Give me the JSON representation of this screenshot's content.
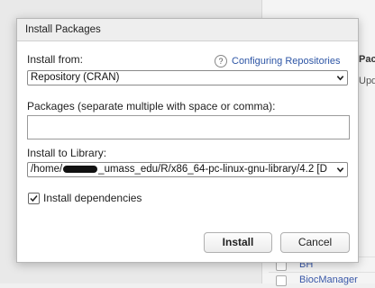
{
  "background": {
    "header": "Pac",
    "subheader": "Upd",
    "rows": [
      "BH",
      "BiocManager"
    ]
  },
  "dialog": {
    "title": "Install Packages",
    "install_from_label": "Install from:",
    "help_link": "Configuring Repositories",
    "install_from_value": "Repository (CRAN)",
    "packages_label": "Packages (separate multiple with space or comma):",
    "packages_value": "",
    "install_to_label": "Install to Library:",
    "library_prefix": "/home/",
    "library_suffix": "_umass_edu/R/x86_64-pc-linux-gnu-library/4.2 [D",
    "install_dependencies_label": "Install dependencies",
    "install_dependencies_checked": true,
    "install_button": "Install",
    "cancel_button": "Cancel"
  }
}
